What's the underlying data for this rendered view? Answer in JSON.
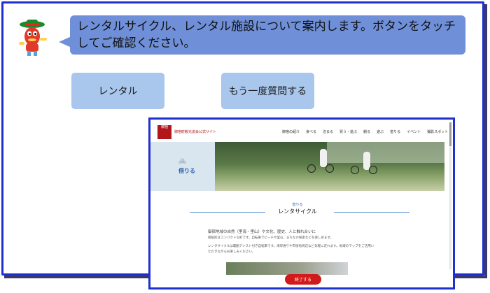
{
  "speech": {
    "text": "レンタルサイクル、レンタル施設について案内します。ボタンをタッチしてご確認ください。"
  },
  "buttons": {
    "rental": "レンタル",
    "ask_again": "もう一度質問する"
  },
  "site": {
    "logo_text": "御宿",
    "name": "御宿町観光協会公式サイト",
    "nav": [
      "御宿の紹介",
      "食べる",
      "泊まる",
      "買う・遊ぶ",
      "観る",
      "遊ぶ",
      "借りる",
      "イベント",
      "撮影スポット"
    ],
    "hero_label": "借りる",
    "section_small": "借りる",
    "section_title": "レンタサイクル",
    "para1": "御宿地域の自然（里海・里山）や文化、歴史、人と触れ合いに",
    "para2": "御宿町はコンパクトな町です。自転車でビーチや里山、まちなか探索などを楽しめます。",
    "para3": "レンタサイクルは電動アシスト付き自転車です。海岸通りや市街地周辺など気軽に走れます。地域のマップをご活用い",
    "para4": "ただきながらお楽しみください。",
    "end_button": "終了する"
  },
  "colors": {
    "frame": "#1f2fd0",
    "bubble": "#6f90d8",
    "button": "#a9c6ec",
    "brand_red": "#b2161b",
    "end_button": "#d11a1a"
  }
}
